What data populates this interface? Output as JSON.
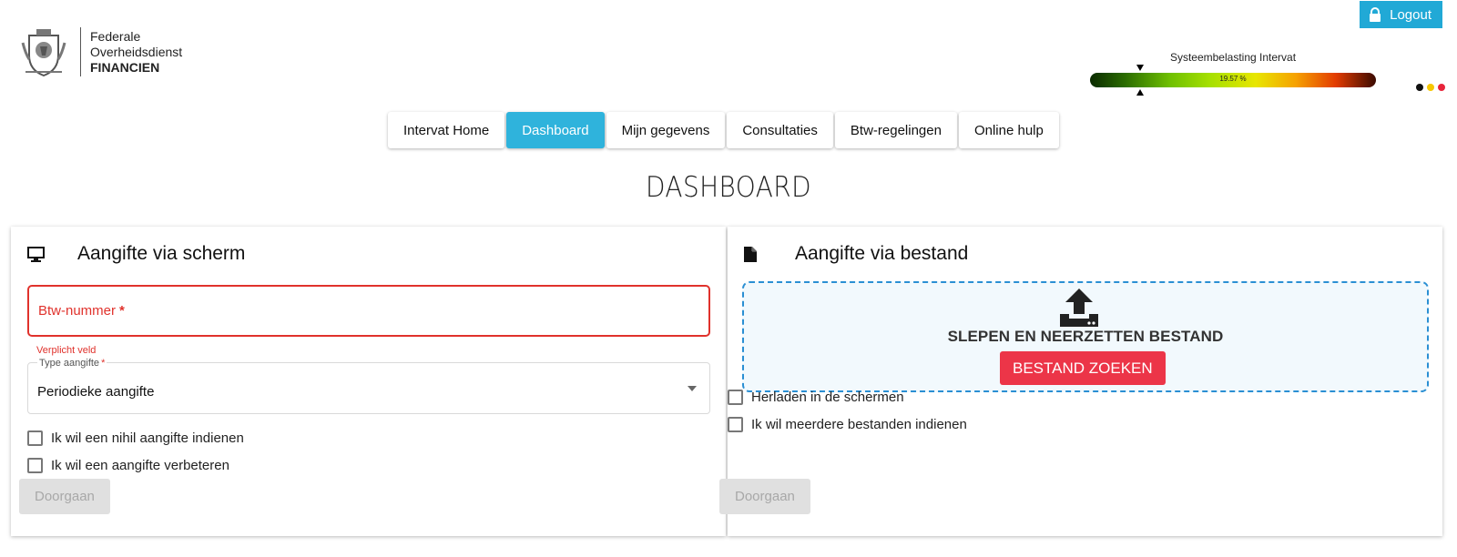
{
  "header": {
    "logo_line1": "Federale",
    "logo_line2": "Overheidsdienst",
    "logo_line3": "FINANCIEN",
    "logout_label": "Logout",
    "load_title": "Systeembelasting Intervat",
    "load_value": "19.57 %",
    "load_fraction": 0.1957,
    "flag_colors": [
      "#111111",
      "#f6c700",
      "#e8243a"
    ]
  },
  "nav": {
    "items": [
      {
        "label": "Intervat Home"
      },
      {
        "label": "Dashboard"
      },
      {
        "label": "Mijn gegevens"
      },
      {
        "label": "Consultaties"
      },
      {
        "label": "Btw-regelingen"
      },
      {
        "label": "Online hulp"
      }
    ],
    "active": "Dashboard"
  },
  "page_title": "DASHBOARD",
  "screen_card": {
    "title": "Aangifte via scherm",
    "icon": "monitor-icon",
    "vat_label": "Btw-nummer",
    "required_marker": "*",
    "error_message": "Verplicht veld",
    "type_label": "Type aangifte",
    "type_value": "Periodieke aangifte",
    "check1": "Ik wil een nihil aangifte indienen",
    "check2": "Ik wil een aangifte verbeteren",
    "continue_label": "Doorgaan"
  },
  "file_card": {
    "title": "Aangifte via bestand",
    "icon": "file-icon",
    "drop_text": "SLEPEN EN NEERZETTEN BESTAND",
    "browse_label": "BESTAND ZOEKEN",
    "check1": "Herladen in de schermen",
    "check2": "Ik wil meerdere bestanden indienen",
    "continue_label": "Doorgaan"
  },
  "colors": {
    "accent": "#2fb3dc",
    "error": "#e0322c",
    "browse_button": "#ec3548",
    "dropzone_border": "#2a8fd3"
  }
}
